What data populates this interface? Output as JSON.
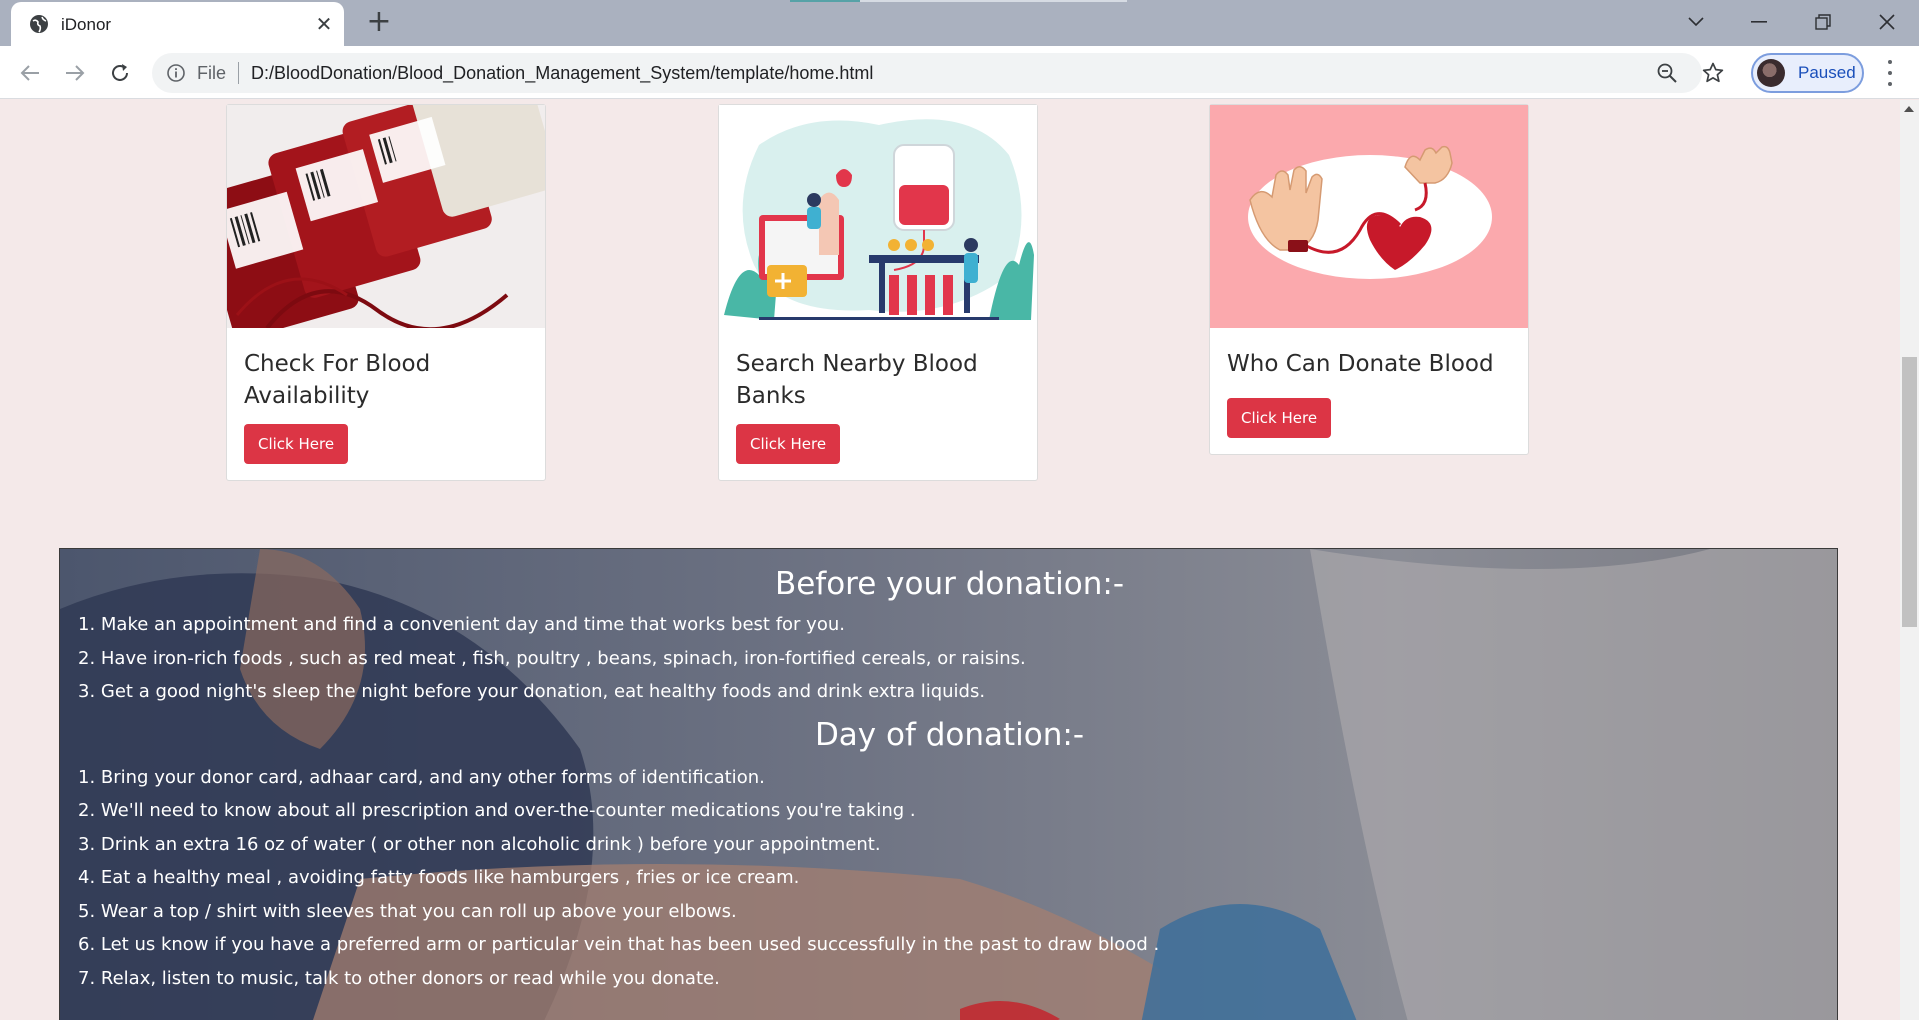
{
  "browser": {
    "tab_title": "iDonor",
    "omnibox": {
      "scheme_label": "File",
      "url": "D:/BloodDonation/Blood_Donation_Management_System/template/home.html"
    },
    "profile_label": "Paused",
    "colors": {
      "tabbar": "#aab1bf",
      "toolbar": "#ffffff",
      "profile_text": "#1a4fba"
    }
  },
  "page": {
    "colors": {
      "background": "#f4e9e9",
      "button": "#dc3545",
      "overlay_text": "#ffffff"
    },
    "cards": [
      {
        "title": "Check For Blood Availability",
        "button": "Click Here",
        "image": "blood-bags-photo"
      },
      {
        "title": "Search Nearby Blood Banks",
        "button": "Click Here",
        "image": "blood-bank-illustration"
      },
      {
        "title": "Who Can Donate Blood",
        "button": "Click Here",
        "image": "hands-heart-illustration"
      }
    ],
    "info": {
      "before_heading": "Before your donation:-",
      "before_items": [
        "1. Make an appointment and find a convenient day and time that works best for you.",
        "2. Have iron-rich foods , such as red meat , fish, poultry , beans, spinach, iron-fortified cereals, or raisins.",
        "3. Get a good night's sleep the night before your donation, eat healthy foods and drink extra liquids."
      ],
      "day_heading": "Day of donation:-",
      "day_items": [
        "1. Bring your donor card, adhaar card, and any other forms of identification.",
        "2. We'll need to know about all prescription and over-the-counter medications you're taking .",
        "3. Drink an extra 16 oz of water ( or other non alcoholic drink ) before your appointment.",
        "4. Eat a healthy meal , avoiding fatty foods like hamburgers , fries or ice cream.",
        "5. Wear a top / shirt with sleeves that you can roll up above your elbows.",
        "6. Let us know if you have a preferred arm or particular vein that has been used successfully in the past to draw blood .",
        "7. Relax, listen to music, talk to other donors or read while you donate."
      ]
    }
  }
}
